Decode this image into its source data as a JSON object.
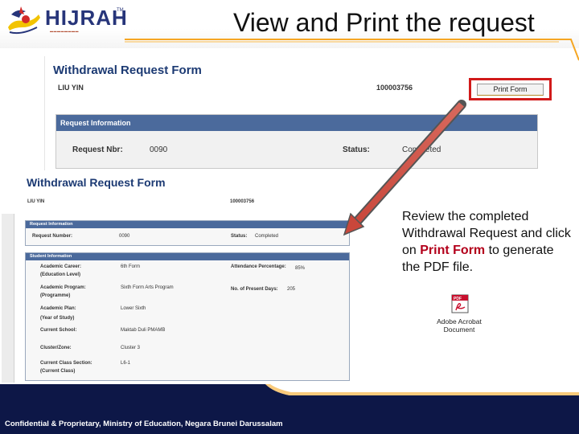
{
  "slide": {
    "title": "View and Print the request",
    "logo_text": "HIJRAH",
    "logo_tm": "TM",
    "footer": "Confidential & Proprietary, Ministry of Education, Negara Brunei Darussalam"
  },
  "colors": {
    "accent": "#f5a623",
    "highlight": "#b3001b",
    "header_blue": "#4b6a9c",
    "arrow": "#c9473b"
  },
  "screenshot_top": {
    "form_title": "Withdrawal Request Form",
    "student_name": "LIU YIN",
    "student_id": "100003756",
    "print_button": "Print Form",
    "section_header": "Request Information",
    "request_nbr_label": "Request Nbr:",
    "request_nbr_value": "0090",
    "status_label": "Status:",
    "status_value": "Completed"
  },
  "screenshot_pdf": {
    "form_title": "Withdrawal Request Form",
    "student_name": "LIU YIN",
    "student_id": "100003756",
    "request_header": "Request Information",
    "request_number_label": "Request Number:",
    "request_number_value": "0090",
    "status_label": "Status:",
    "status_value": "Completed",
    "student_header": "Student Information",
    "academic_career_label": "Academic Career:",
    "academic_career_sub": "(Education Level)",
    "academic_career_value": "6th Form",
    "attendance_label": "Attendance Percentage:",
    "attendance_value": "85%",
    "academic_program_label": "Academic Program:",
    "academic_program_sub": "(Programme)",
    "academic_program_value": "Sixth Form Arts Program",
    "present_days_label": "No. of Present Days:",
    "present_days_value": "205",
    "academic_plan_label": "Academic Plan:",
    "academic_plan_sub": "(Year of Study)",
    "academic_plan_value": "Lower Sixth",
    "current_school_label": "Current School:",
    "current_school_value": "Maktab Duli PMAMB",
    "cluster_label": "Cluster/Zone:",
    "cluster_value": "Cluster 3",
    "class_section_label": "Current Class Section:",
    "class_section_sub": "(Current Class)",
    "class_section_value": "L6-1"
  },
  "instruction": {
    "part1": "Review the completed Withdrawal Request and click on ",
    "highlight": "Print Form",
    "part2": " to generate the PDF file."
  },
  "pdf_file": {
    "icon": "pdf-icon",
    "label": "Adobe Acrobat Document"
  }
}
